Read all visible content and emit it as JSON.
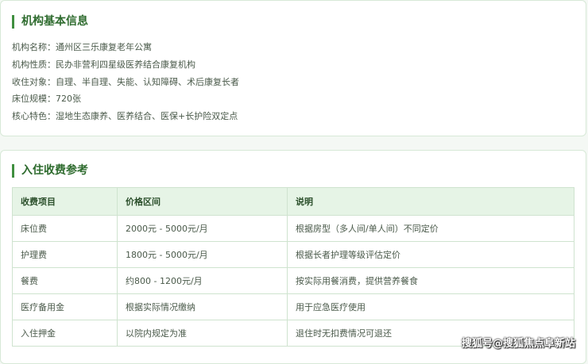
{
  "basic_info": {
    "title": "机构基本信息",
    "rows": [
      {
        "label": "机构名称：",
        "value": "通州区三乐康复老年公寓"
      },
      {
        "label": "机构性质：",
        "value": "民办非营利四星级医养结合康复机构"
      },
      {
        "label": "收住对象：",
        "value": "自理、半自理、失能、认知障碍、术后康复长者"
      },
      {
        "label": "床位规模：",
        "value": "720张"
      },
      {
        "label": "核心特色：",
        "value": "湿地生态康养、医养结合、医保+长护险双定点"
      }
    ]
  },
  "fees": {
    "title": "入住收费参考",
    "headers": [
      "收费项目",
      "价格区间",
      "说明"
    ],
    "rows": [
      [
        "床位费",
        "2000元 - 5000元/月",
        "根据房型（多人间/单人间）不同定价"
      ],
      [
        "护理费",
        "1800元 - 5000元/月",
        "根据长者护理等级评估定价"
      ],
      [
        "餐费",
        "约800 - 1200元/月",
        "按实际用餐消费，提供营养餐食"
      ],
      [
        "医疗备用金",
        "根据实际情况缴纳",
        "用于应急医疗使用"
      ],
      [
        "入住押金",
        "以院内规定为准",
        "退住时无扣费情况可退还"
      ]
    ]
  },
  "watermark": "搜狐号@搜狐焦点阜新站"
}
